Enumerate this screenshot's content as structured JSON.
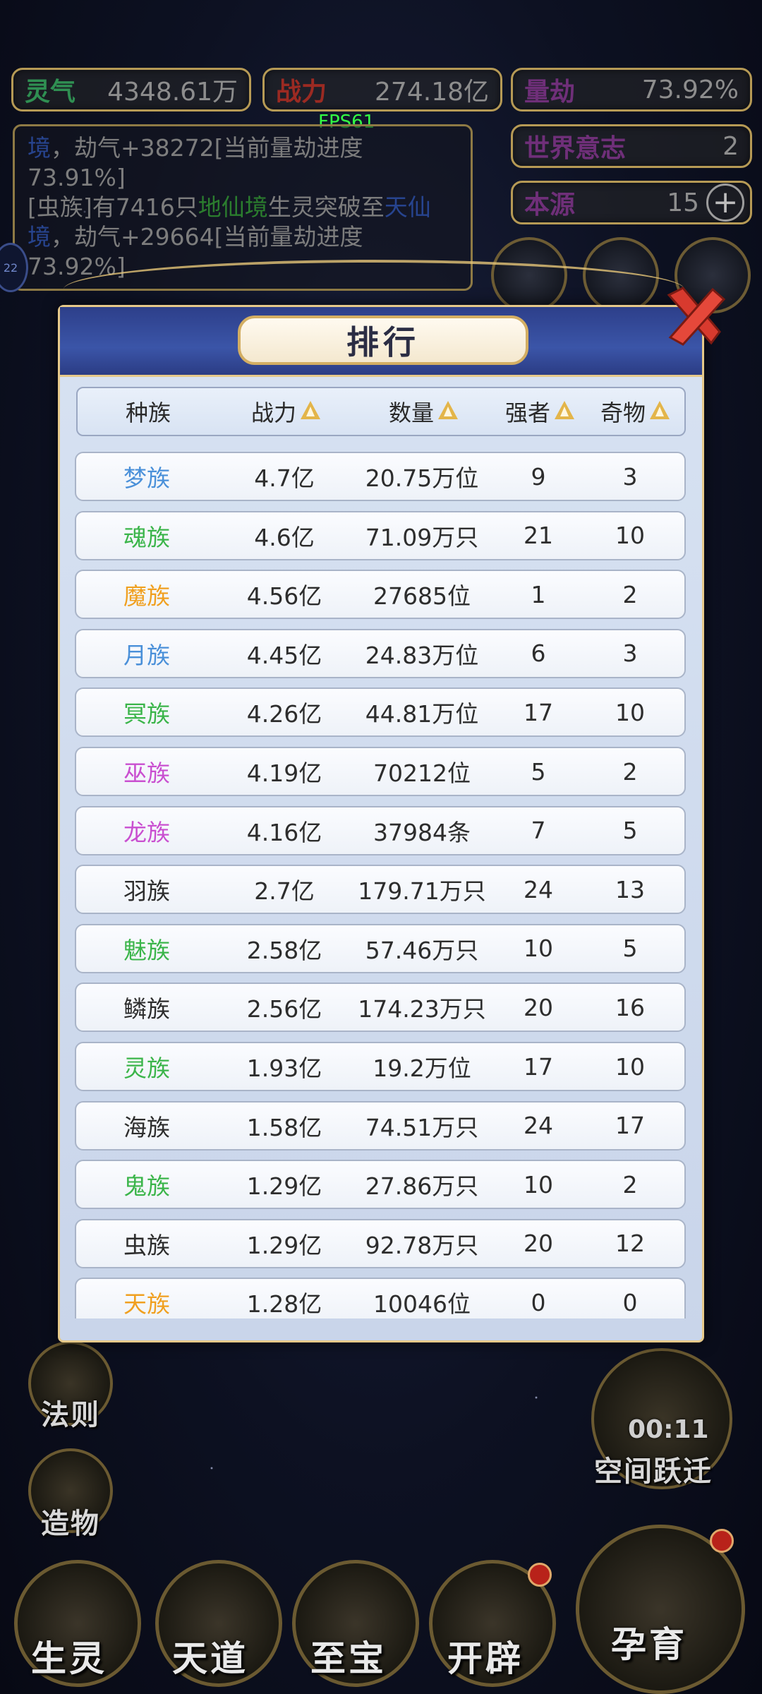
{
  "hud": {
    "lingqi": {
      "label": "灵气",
      "value": "4348.61万"
    },
    "zhanli": {
      "label": "战力",
      "value": "274.18亿"
    },
    "liangjie": {
      "label": "量劫",
      "value": "73.92%"
    },
    "shijie": {
      "label": "世界意志",
      "value": "2"
    },
    "benyuan": {
      "label": "本源",
      "value": "15",
      "plus": "+"
    },
    "fps": "FPS61"
  },
  "log": {
    "l1a": "境，劫气+38272[当前量劫进度",
    "l2": "73.91%]",
    "l3a": "[虫族]有7416只",
    "l3b": "地仙境",
    "l3c": "生灵突破至",
    "l3d": "天仙",
    "l4": "境，劫气+29664[当前量劫进度",
    "l5": "73.92%]"
  },
  "modal": {
    "title": "排行",
    "headers": [
      "种族",
      "战力",
      "数量",
      "强者",
      "奇物"
    ],
    "rows": [
      {
        "race": "梦族",
        "power": "4.7亿",
        "count": "20.75万位",
        "strong": "9",
        "items": "3",
        "color": "#4a90d9"
      },
      {
        "race": "魂族",
        "power": "4.6亿",
        "count": "71.09万只",
        "strong": "21",
        "items": "10",
        "color": "#3bb54a"
      },
      {
        "race": "魔族",
        "power": "4.56亿",
        "count": "27685位",
        "strong": "1",
        "items": "2",
        "color": "#f0a020"
      },
      {
        "race": "月族",
        "power": "4.45亿",
        "count": "24.83万位",
        "strong": "6",
        "items": "3",
        "color": "#4a90d9"
      },
      {
        "race": "冥族",
        "power": "4.26亿",
        "count": "44.81万位",
        "strong": "17",
        "items": "10",
        "color": "#3bb54a"
      },
      {
        "race": "巫族",
        "power": "4.19亿",
        "count": "70212位",
        "strong": "5",
        "items": "2",
        "color": "#c94fd0"
      },
      {
        "race": "龙族",
        "power": "4.16亿",
        "count": "37984条",
        "strong": "7",
        "items": "5",
        "color": "#c94fd0"
      },
      {
        "race": "羽族",
        "power": "2.7亿",
        "count": "179.71万只",
        "strong": "24",
        "items": "13",
        "color": "#2d2d2d"
      },
      {
        "race": "魅族",
        "power": "2.58亿",
        "count": "57.46万只",
        "strong": "10",
        "items": "5",
        "color": "#3bb54a"
      },
      {
        "race": "鳞族",
        "power": "2.56亿",
        "count": "174.23万只",
        "strong": "20",
        "items": "16",
        "color": "#2d2d2d"
      },
      {
        "race": "灵族",
        "power": "1.93亿",
        "count": "19.2万位",
        "strong": "17",
        "items": "10",
        "color": "#3bb54a"
      },
      {
        "race": "海族",
        "power": "1.58亿",
        "count": "74.51万只",
        "strong": "24",
        "items": "17",
        "color": "#2d2d2d"
      },
      {
        "race": "鬼族",
        "power": "1.29亿",
        "count": "27.86万只",
        "strong": "10",
        "items": "2",
        "color": "#3bb54a"
      },
      {
        "race": "虫族",
        "power": "1.29亿",
        "count": "92.78万只",
        "strong": "20",
        "items": "12",
        "color": "#2d2d2d"
      },
      {
        "race": "天族",
        "power": "1.28亿",
        "count": "10046位",
        "strong": "0",
        "items": "0",
        "color": "#f0a020"
      }
    ]
  },
  "dock": {
    "fazi": "法则",
    "zaowu": "造物",
    "timer": "00:11",
    "kongjian": "空间跃迁",
    "shengling": "生灵",
    "tiandao": "天道",
    "zhibao": "至宝",
    "kaipi": "开辟",
    "yunyu": "孕育"
  }
}
